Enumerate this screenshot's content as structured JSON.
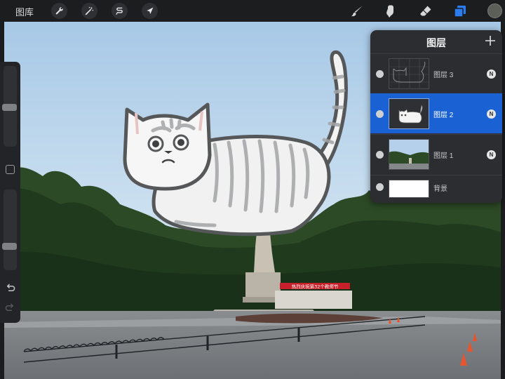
{
  "toolbar": {
    "gallery_label": "图库",
    "tools": [
      {
        "icon": "wrench-icon"
      },
      {
        "icon": "magic-wand-icon"
      },
      {
        "icon": "selection-icon"
      },
      {
        "icon": "transform-arrow-icon"
      }
    ],
    "right_tools": [
      {
        "icon": "brush-icon"
      },
      {
        "icon": "smudge-icon"
      },
      {
        "icon": "eraser-icon"
      },
      {
        "icon": "layers-icon",
        "active": true
      }
    ],
    "current_color": "#5b5f58"
  },
  "canvas": {
    "banner_text": "热烈庆祝第32个教师节"
  },
  "layers_panel": {
    "title": "图层",
    "add_symbol": "+",
    "layers": [
      {
        "name": "图层 3",
        "blend": "N",
        "selected": false
      },
      {
        "name": "图层 2",
        "blend": "N",
        "selected": true
      },
      {
        "name": "图层 1",
        "blend": "N",
        "selected": false
      },
      {
        "name": "背景",
        "blend": "",
        "selected": false
      }
    ]
  },
  "colors": {
    "accent": "#1a61d3",
    "toolbar_bg": "#1c1d1f",
    "panel_bg": "#2b2d31"
  }
}
